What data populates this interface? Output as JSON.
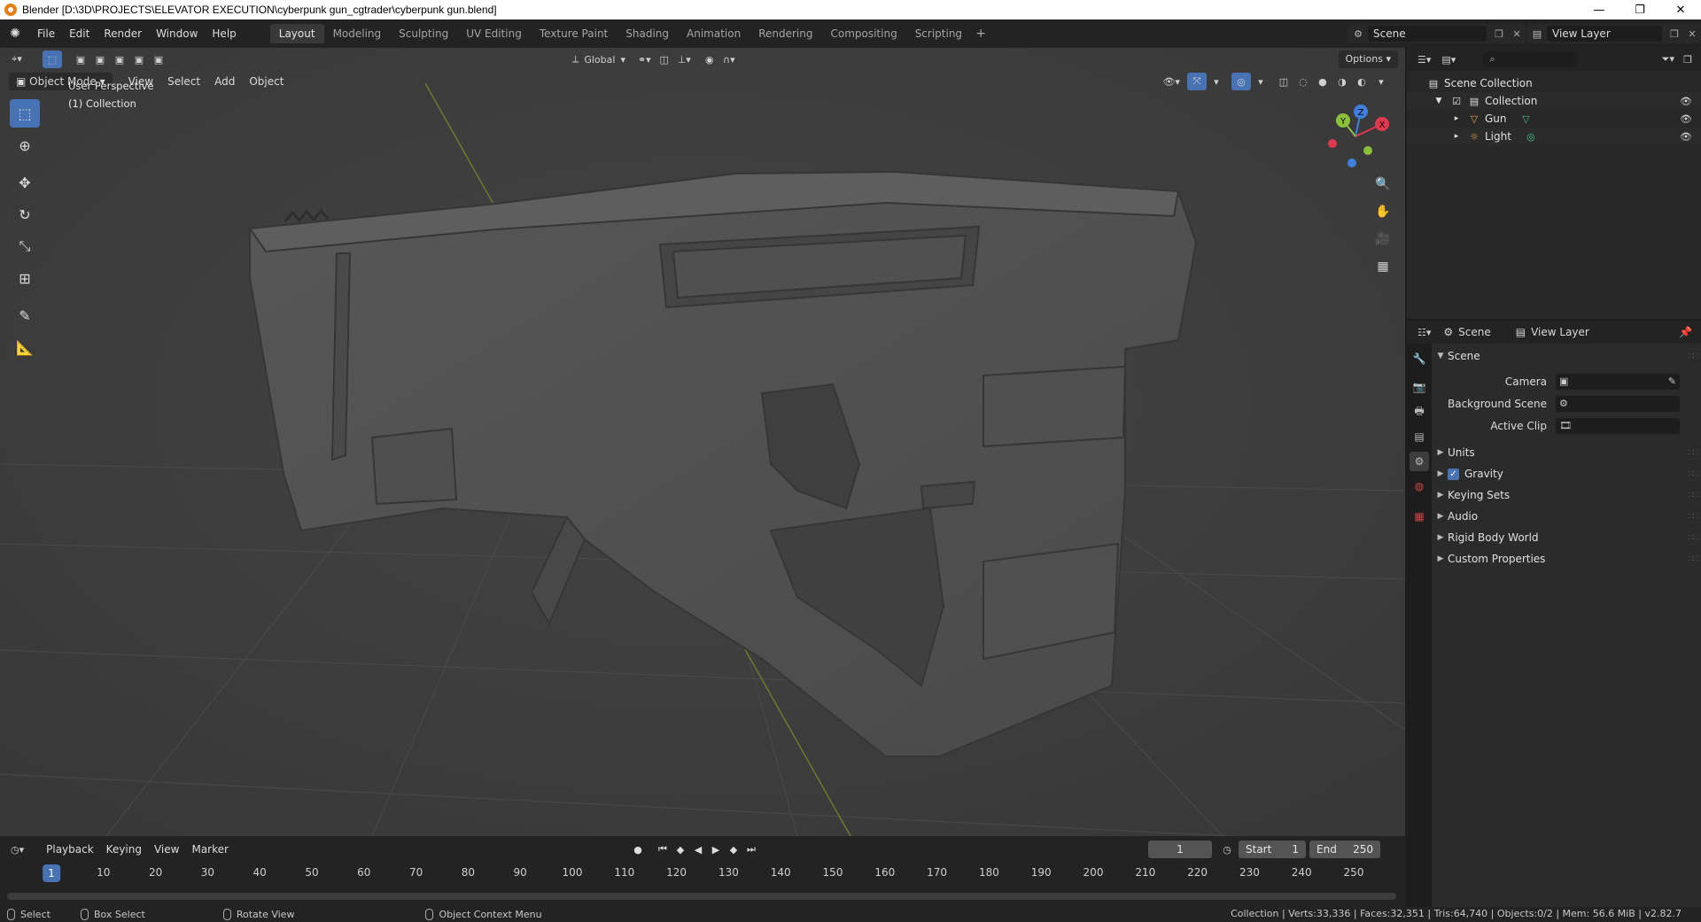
{
  "window": {
    "title": "Blender [D:\\3D\\PROJECTS\\ELEVATOR EXECUTION\\cyberpunk gun_cgtrader\\cyberpunk gun.blend]",
    "minimize": "—",
    "restore": "❐",
    "close": "✕"
  },
  "menu": {
    "file": "File",
    "edit": "Edit",
    "render": "Render",
    "window": "Window",
    "help": "Help"
  },
  "workspaces": [
    "Layout",
    "Modeling",
    "Sculpting",
    "UV Editing",
    "Texture Paint",
    "Shading",
    "Animation",
    "Rendering",
    "Compositing",
    "Scripting"
  ],
  "scene_selector": {
    "value": "Scene"
  },
  "view_layer_selector": {
    "value": "View Layer"
  },
  "viewport": {
    "transform_orientation": "Global",
    "options_label": "Options",
    "mode": "Object Mode",
    "menus": {
      "view": "View",
      "select": "Select",
      "add": "Add",
      "object": "Object"
    },
    "overlay_line1": "User Perspective",
    "overlay_line2": "(1) Collection",
    "gizmo": {
      "z": "Z",
      "y": "Y",
      "x": "X"
    }
  },
  "outliner": {
    "items": [
      {
        "label": "Scene Collection"
      },
      {
        "label": "Collection"
      },
      {
        "label": "Gun"
      },
      {
        "label": "Light"
      }
    ]
  },
  "properties": {
    "tab_scene": "Scene",
    "tab_view_layer": "View Layer",
    "panel_scene": "Scene",
    "fields": {
      "camera": "Camera",
      "background_scene": "Background Scene",
      "active_clip": "Active Clip"
    },
    "panels": [
      "Units",
      "Gravity",
      "Keying Sets",
      "Audio",
      "Rigid Body World",
      "Custom Properties"
    ],
    "gravity_checked": true
  },
  "timeline": {
    "menus": {
      "playback": "Playback",
      "keying": "Keying",
      "view": "View",
      "marker": "Marker"
    },
    "current_frame": "1",
    "start_label": "Start",
    "start_value": "1",
    "end_label": "End",
    "end_value": "250",
    "ruler_current": "1",
    "ticks": [
      "10",
      "20",
      "30",
      "40",
      "50",
      "60",
      "70",
      "80",
      "90",
      "100",
      "110",
      "120",
      "130",
      "140",
      "150",
      "160",
      "170",
      "180",
      "190",
      "200",
      "210",
      "220",
      "230",
      "240",
      "250"
    ]
  },
  "statusbar": {
    "select": "Select",
    "box_select": "Box Select",
    "rotate_view": "Rotate View",
    "context_menu": "Object Context Menu",
    "stats": "Collection | Verts:33,336 | Faces:32,351 | Tris:64,740 | Objects:0/2 | Mem: 56.6 MiB | v2.82.7"
  },
  "colors": {
    "accent": "#4772b3",
    "viewport_bg": "#3d3d3d",
    "axis_x": "#e0394f",
    "axis_y": "#8bc13a",
    "axis_z": "#3f7fe0"
  }
}
